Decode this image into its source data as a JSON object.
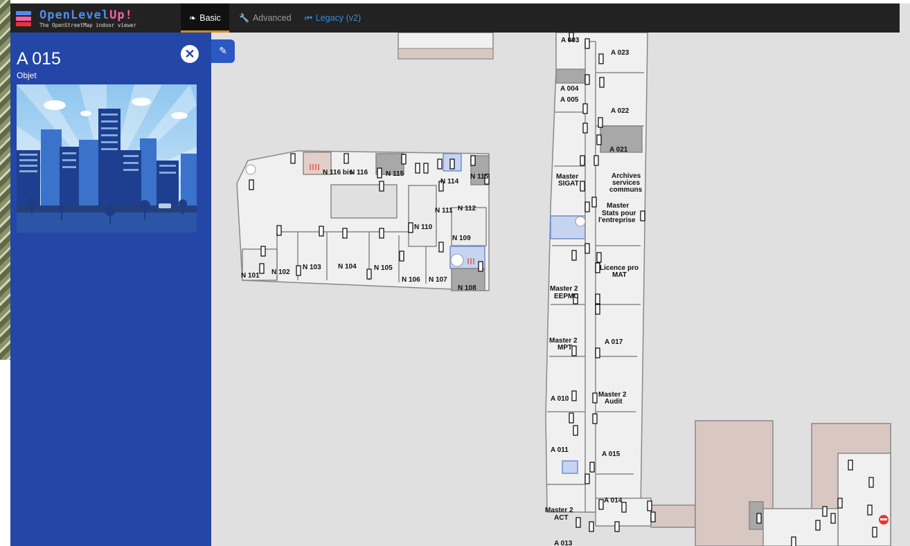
{
  "app": {
    "title": "OpenLevelUp!",
    "title_part1": "OpenLevel",
    "title_part2": "Up!",
    "subtitle": "The OpenStreetMap indoor viewer",
    "logo_icon": "stacked-levels-icon"
  },
  "nav": {
    "tabs": [
      {
        "label": "Basic",
        "icon": "leaf-icon",
        "active": true
      },
      {
        "label": "Advanced",
        "icon": "wrench-icon",
        "active": false
      },
      {
        "label": "Legacy (v2)",
        "icon": "fast-backward-icon",
        "active": false
      }
    ]
  },
  "sidebar": {
    "room_name": "A 015",
    "room_type": "Objet",
    "close_icon": "close-icon",
    "image": "city-skyline-illustration"
  },
  "comment_button": {
    "icon": "speech-bubble-icon"
  },
  "colors": {
    "navbar": "#222222",
    "sidebar": "#2446a6",
    "accent_tab": "#d48a1e",
    "legacy_link": "#3a8bd8",
    "room_fill": "#f0f0f0",
    "room_dark": "#a8a8a8",
    "room_pink": "#d9c7c2",
    "stairs_blue": "#c6d4f0"
  },
  "map": {
    "labels": [
      "N 116 bis",
      "N 116",
      "N 115",
      "N 115",
      "N 114",
      "N 111",
      "N 112",
      "N 110",
      "N 109",
      "N 101",
      "N 102",
      "N 103",
      "N 104",
      "N 105",
      "N 106",
      "N 107",
      "N 108",
      "A 003",
      "A 023",
      "A 004",
      "A 005",
      "A 022",
      "A 021",
      "Master",
      "SIGAT",
      "Archives",
      "services",
      "communs",
      "Master",
      "Stats pour",
      "l'entreprise",
      "Licence pro",
      "MAT",
      "Master 2",
      "EEPMC",
      "Master 2",
      "MPT",
      "A 017",
      "A 010",
      "Master 2",
      "Audit",
      "A 011",
      "A 015",
      "A 014",
      "Master 2",
      "ACT",
      "A 013"
    ]
  }
}
